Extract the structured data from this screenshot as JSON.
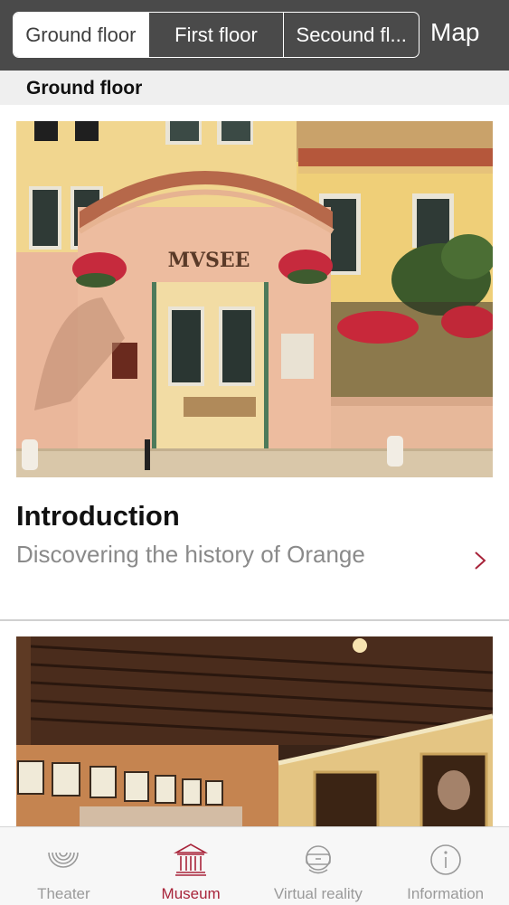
{
  "header": {
    "segments": [
      "Ground floor",
      "First floor",
      "Secound fl..."
    ],
    "active_segment": "Ground floor",
    "map_label": "Map"
  },
  "section": {
    "title": "Ground floor"
  },
  "cards": [
    {
      "title": "Introduction",
      "subtitle": "Discovering the history of Orange",
      "image_text": "MVSEE"
    },
    {
      "title": "",
      "subtitle": ""
    }
  ],
  "tabs": [
    {
      "label": "Theater",
      "icon": "theater-arcs-icon"
    },
    {
      "label": "Museum",
      "icon": "museum-building-icon",
      "active": true
    },
    {
      "label": "Virtual reality",
      "icon": "vr-headset-icon"
    },
    {
      "label": "Information",
      "icon": "info-circle-icon"
    }
  ],
  "colors": {
    "topbar": "#4a4a4a",
    "active_tab": "#a8243a",
    "inactive_tab": "#9a9a9a",
    "section_bg": "#efefef"
  }
}
